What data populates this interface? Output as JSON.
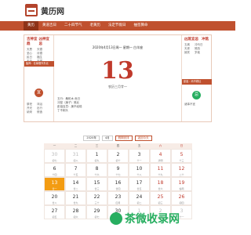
{
  "brand": {
    "name": "黄历网"
  },
  "nav": [
    "黄历",
    "黄道吉日",
    "二十四节气",
    "老黄历",
    "法定节假日",
    "抽签算命"
  ],
  "left_panel": {
    "yi_title": "吉神宜趋",
    "ji_title": "凶神宜忌",
    "col1": [
      "天恩",
      "圣心",
      "民日",
      "天马"
    ],
    "col2": [
      "天德",
      "月德",
      "福生",
      "玉堂"
    ],
    "band": "胎神：仓库栖外东北",
    "seal": "宜",
    "list": [
      "祭祀",
      "沐浴",
      "开光",
      "出行",
      "纳采",
      "修造"
    ]
  },
  "right_panel": {
    "ji_title": "凶煞宜忌",
    "chong_title": "冲煞",
    "col1": [
      "五离",
      "天吏",
      "致死"
    ],
    "col2": [
      "冲马日",
      "煞西",
      "岁破"
    ],
    "band": "彭祖：丙不修灶",
    "seal": "忌",
    "list": [
      "诸事不宜"
    ]
  },
  "center": {
    "date_line": "2020年4月13日周一  星期一  白羊座",
    "day": "13",
    "lunar": "农历三月廿一",
    "notes": [
      "五行：桑柘木 危日",
      "冲鼠（庚子）煞北",
      "彭祖百忌：庚不经络",
      "丁不剃头"
    ]
  },
  "calendar": {
    "year": "2020年",
    "month": "4月",
    "btn_holiday": "假期安排",
    "btn_today": "返回今天",
    "weekdays": [
      "一",
      "二",
      "三",
      "四",
      "五",
      "六",
      "日"
    ],
    "weeks": [
      [
        {
          "n": "30",
          "s": "初七",
          "o": true
        },
        {
          "n": "31",
          "s": "初八",
          "o": true
        },
        {
          "n": "1",
          "s": "初九"
        },
        {
          "n": "2",
          "s": "初十"
        },
        {
          "n": "3",
          "s": "十一"
        },
        {
          "n": "4",
          "s": "清明",
          "w": true
        },
        {
          "n": "5",
          "s": "十三",
          "w": true
        }
      ],
      [
        {
          "n": "6",
          "s": "十四"
        },
        {
          "n": "7",
          "s": "十五"
        },
        {
          "n": "8",
          "s": "十六"
        },
        {
          "n": "9",
          "s": "十七"
        },
        {
          "n": "10",
          "s": "十八"
        },
        {
          "n": "11",
          "s": "十九",
          "w": true
        },
        {
          "n": "12",
          "s": "二十",
          "w": true
        }
      ],
      [
        {
          "n": "13",
          "s": "廿一",
          "t": true
        },
        {
          "n": "14",
          "s": "廿二"
        },
        {
          "n": "15",
          "s": "廿三"
        },
        {
          "n": "16",
          "s": "廿四"
        },
        {
          "n": "17",
          "s": "廿五"
        },
        {
          "n": "18",
          "s": "廿六",
          "w": true
        },
        {
          "n": "19",
          "s": "谷雨",
          "w": true
        }
      ],
      [
        {
          "n": "20",
          "s": "廿八"
        },
        {
          "n": "21",
          "s": "廿九"
        },
        {
          "n": "22",
          "s": "三十"
        },
        {
          "n": "23",
          "s": "四月"
        },
        {
          "n": "24",
          "s": "初二"
        },
        {
          "n": "25",
          "s": "初三",
          "w": true
        },
        {
          "n": "26",
          "s": "初四",
          "w": true
        }
      ],
      [
        {
          "n": "27",
          "s": "初五"
        },
        {
          "n": "28",
          "s": "初六"
        },
        {
          "n": "29",
          "s": "初七"
        },
        {
          "n": "30",
          "s": "初八"
        },
        {
          "n": "1",
          "s": "劳动节",
          "o": true
        },
        {
          "n": "2",
          "s": "初十",
          "o": true
        },
        {
          "n": "3",
          "s": "十一",
          "o": true
        }
      ]
    ]
  },
  "watermark": {
    "text": "茶微收录网"
  },
  "colors": {
    "accent": "#c0512f",
    "today": "#f39c12",
    "red": "#c0392b",
    "watermark": "#27ae60"
  }
}
